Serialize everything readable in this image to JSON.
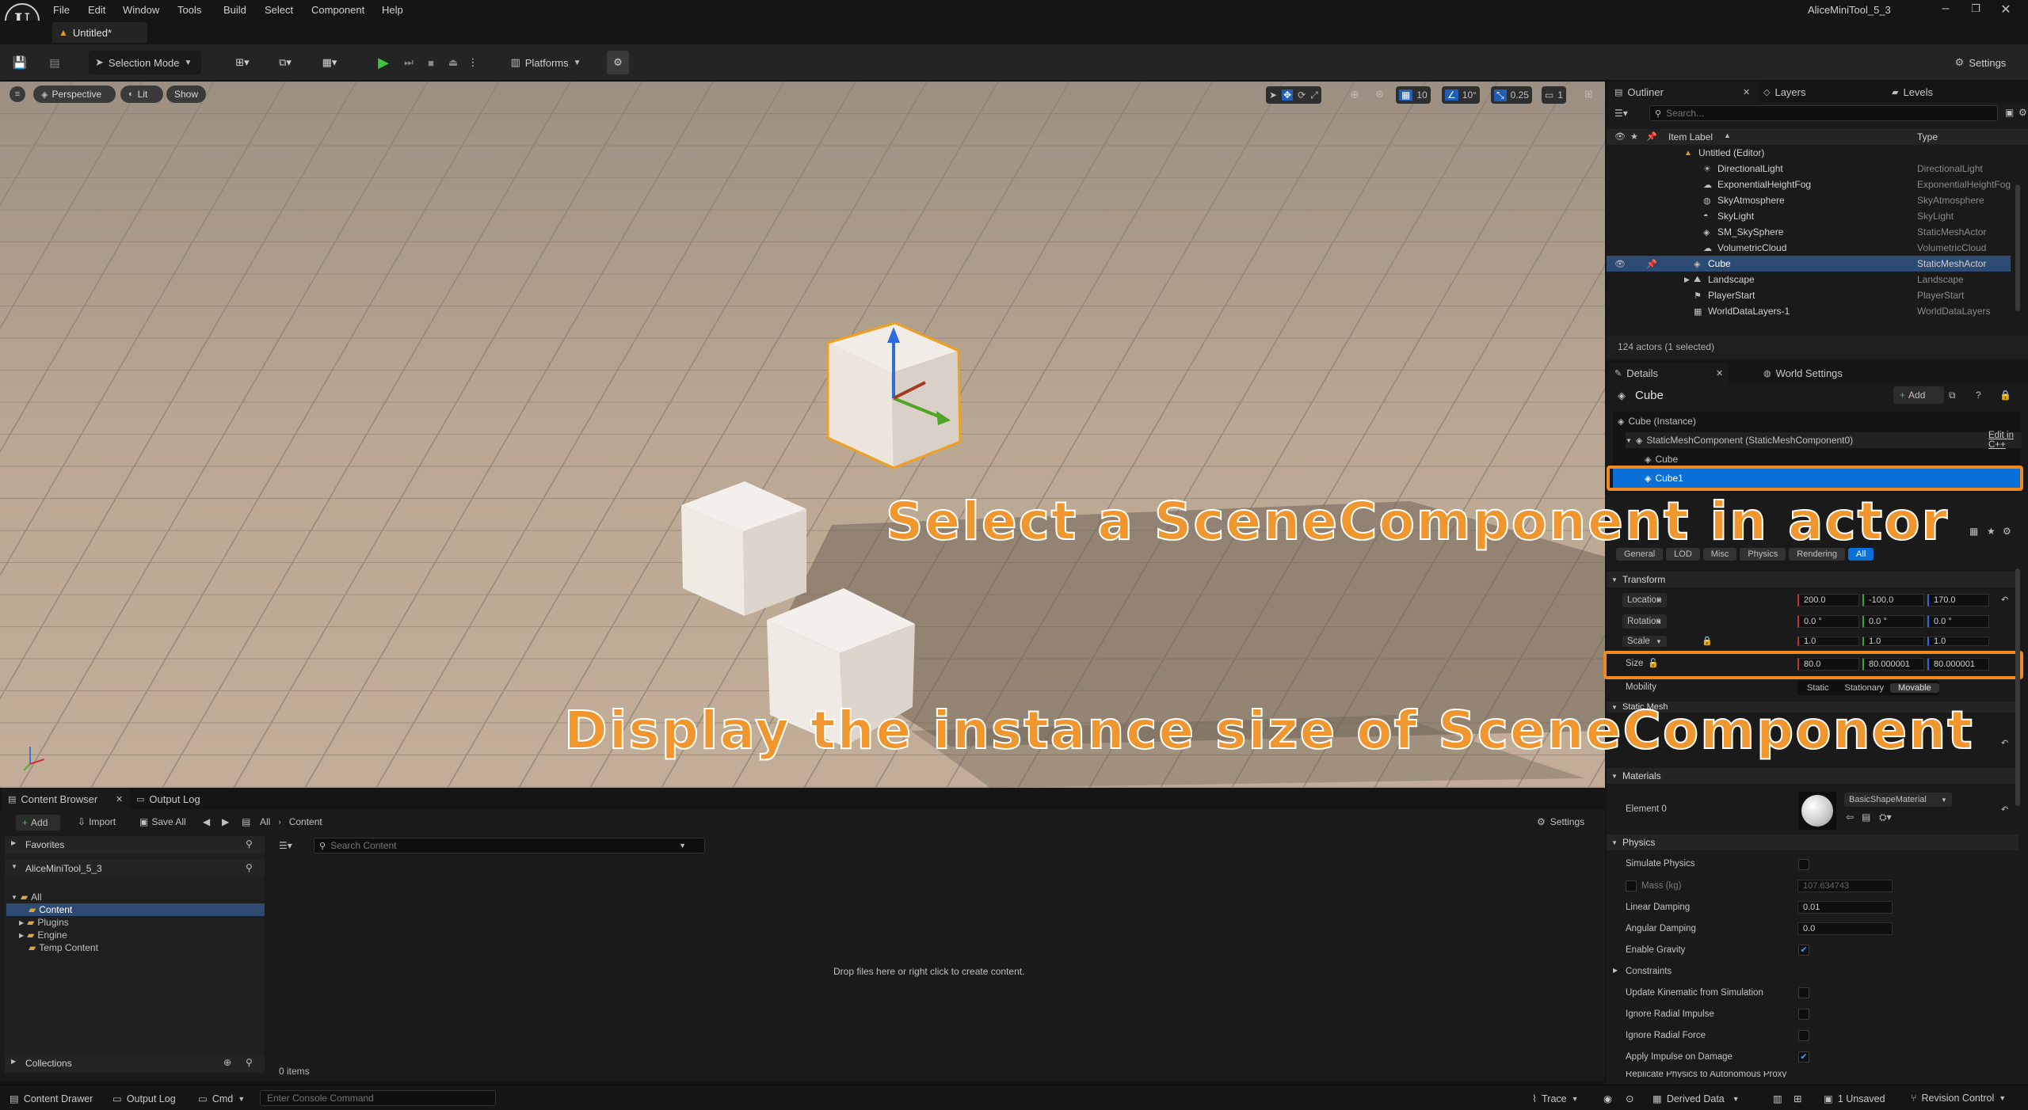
{
  "app": {
    "project_name": "AliceMiniTool_5_3",
    "level_tab": "Untitled*"
  },
  "menu": [
    "File",
    "Edit",
    "Window",
    "Tools",
    "Build",
    "Select",
    "Component",
    "Help"
  ],
  "toolbar": {
    "selection_mode": "Selection Mode",
    "platforms": "Platforms",
    "settings": "Settings"
  },
  "viewport": {
    "perspective": "Perspective",
    "lit": "Lit",
    "show": "Show",
    "grid_snap": "10",
    "rot_snap": "10°",
    "scale_snap": "0.25",
    "cam_speed": "1"
  },
  "overlays": {
    "select_text": "Select a SceneComponent in actor",
    "size_text": "Display the instance size of SceneComponent",
    "color": "#f0962e"
  },
  "outliner": {
    "tabs": [
      "Outliner",
      "Layers",
      "Levels"
    ],
    "search_placeholder": "Search...",
    "col_label": "Item Label",
    "col_type": "Type",
    "rows": [
      {
        "label": "Untitled (Editor)",
        "type": ""
      },
      {
        "label": "DirectionalLight",
        "type": "DirectionalLight"
      },
      {
        "label": "ExponentialHeightFog",
        "type": "ExponentialHeightFog"
      },
      {
        "label": "SkyAtmosphere",
        "type": "SkyAtmosphere"
      },
      {
        "label": "SkyLight",
        "type": "SkyLight"
      },
      {
        "label": "SM_SkySphere",
        "type": "StaticMeshActor"
      },
      {
        "label": "VolumetricCloud",
        "type": "VolumetricCloud"
      },
      {
        "label": "Cube",
        "type": "StaticMeshActor"
      },
      {
        "label": "Landscape",
        "type": "Landscape"
      },
      {
        "label": "PlayerStart",
        "type": "PlayerStart"
      },
      {
        "label": "WorldDataLayers-1",
        "type": "WorldDataLayers"
      }
    ],
    "footer": "124 actors (1 selected)"
  },
  "details": {
    "tabs": [
      "Details",
      "World Settings"
    ],
    "actor_name": "Cube",
    "add_label": "Add",
    "tree": [
      "Cube (Instance)",
      "StaticMeshComponent (StaticMeshComponent0)",
      "Cube",
      "Cube1"
    ],
    "edit_in_cpp": "Edit in C++",
    "filters": [
      "General",
      "LOD",
      "Misc",
      "Physics",
      "Rendering",
      "All"
    ],
    "transform": {
      "section": "Transform",
      "location": {
        "label": "Location",
        "x": "200.0",
        "y": "-100.0",
        "z": "170.0"
      },
      "rotation": {
        "label": "Rotation",
        "x": "0.0 °",
        "y": "0.0 °",
        "z": "0.0 °"
      },
      "scale": {
        "label": "Scale",
        "x": "1.0",
        "y": "1.0",
        "z": "1.0"
      },
      "size": {
        "label": "Size",
        "x": "80.0",
        "y": "80.000001",
        "z": "80.000001"
      },
      "mobility": {
        "label": "Mobility",
        "options": [
          "Static",
          "Stationary",
          "Movable"
        ]
      }
    },
    "static_mesh_section": "Static Mesh",
    "materials": {
      "section": "Materials",
      "element": "Element 0",
      "material": "BasicShapeMaterial"
    },
    "physics": {
      "section": "Physics",
      "simulate": "Simulate Physics",
      "mass": "Mass (kg)",
      "mass_value": "107.634743",
      "linear_damping": "Linear Damping",
      "linear_value": "0.01",
      "angular_damping": "Angular Damping",
      "angular_value": "0.0",
      "enable_gravity": "Enable Gravity",
      "constraints": "Constraints",
      "update_kinematic": "Update Kinematic from Simulation",
      "ignore_impulse": "Ignore Radial Impulse",
      "ignore_force": "Ignore Radial Force",
      "apply_impulse": "Apply Impulse on Damage",
      "replicate": "Replicate Physics to Autonomous Proxy"
    }
  },
  "content_browser": {
    "tabs": [
      "Content Browser",
      "Output Log"
    ],
    "add": "Add",
    "import": "Import",
    "save_all": "Save All",
    "path": [
      "All",
      "Content"
    ],
    "settings": "Settings",
    "favorites": "Favorites",
    "project": "AliceMiniTool_5_3",
    "tree": [
      "All",
      "Content",
      "Plugins",
      "Engine",
      "Temp Content"
    ],
    "collections": "Collections",
    "search_placeholder": "Search Content",
    "empty_hint": "Drop files here or right click to create content.",
    "item_count": "0 items"
  },
  "statusbar": {
    "content_drawer": "Content Drawer",
    "output_log": "Output Log",
    "cmd": "Cmd",
    "console_placeholder": "Enter Console Command",
    "trace": "Trace",
    "derived": "Derived Data",
    "unsaved": "1 Unsaved",
    "revision": "Revision Control"
  }
}
